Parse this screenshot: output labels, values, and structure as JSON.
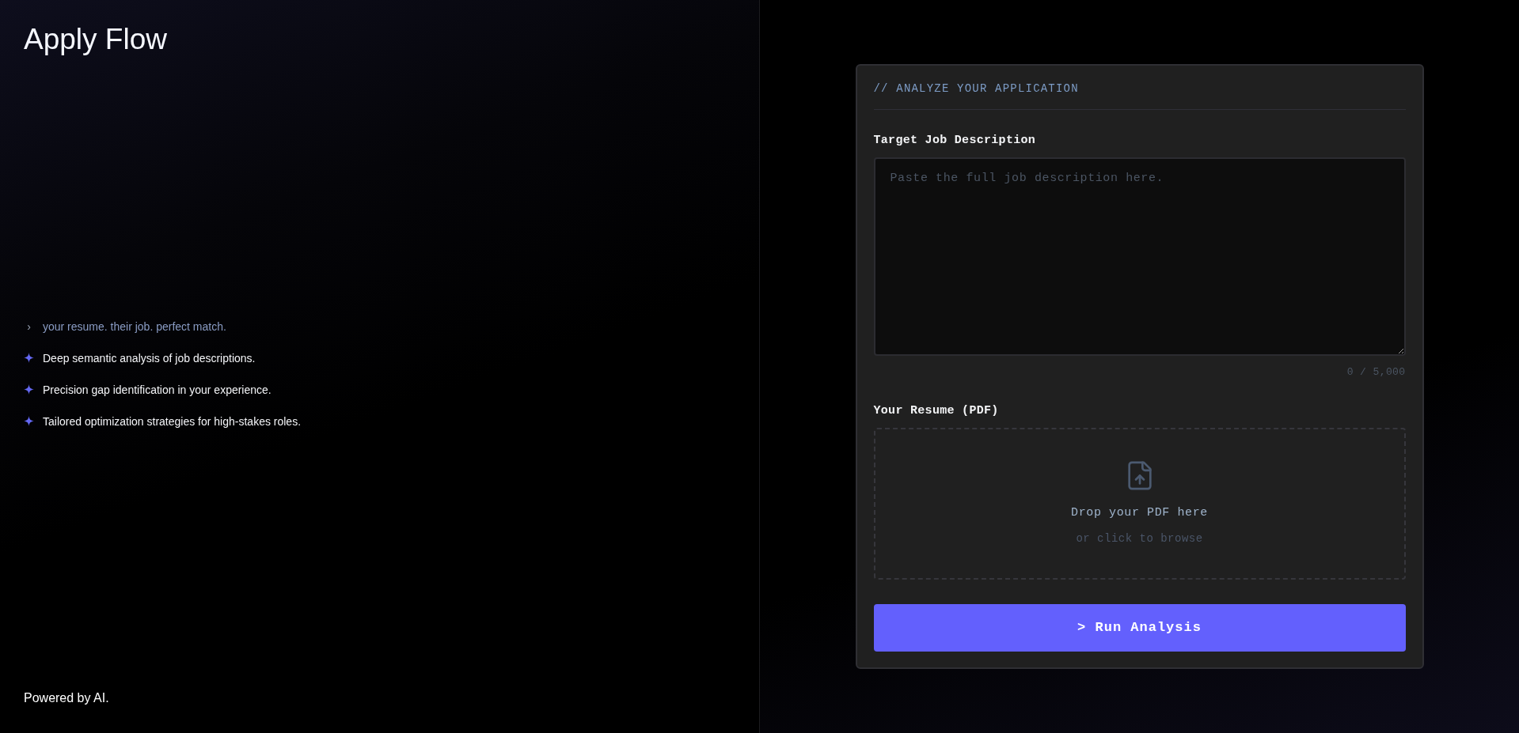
{
  "brand": {
    "title": "Apply Flow"
  },
  "tagline": {
    "prompt": "›",
    "text": "your resume. their job. perfect match."
  },
  "features": [
    {
      "text": "Deep semantic analysis of job descriptions."
    },
    {
      "text": "Precision gap identification in your experience."
    },
    {
      "text": "Tailored optimization strategies for high-stakes roles."
    }
  ],
  "footer": {
    "text": "Powered by AI."
  },
  "form": {
    "heading": "// ANALYZE YOUR APPLICATION",
    "job_description": {
      "label": "Target Job Description",
      "placeholder": "Paste the full job description here.",
      "counter": "0 / 5,000"
    },
    "resume": {
      "label": "Your Resume (PDF)",
      "drop_title": "Drop your PDF here",
      "drop_hint": "or click to browse"
    },
    "submit": {
      "label": "> Run Analysis"
    }
  }
}
